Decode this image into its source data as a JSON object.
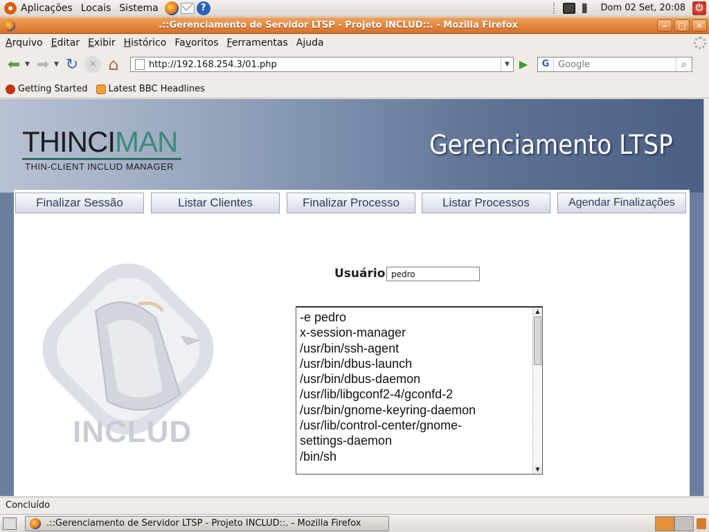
{
  "top_panel": {
    "menus": [
      "Aplicações",
      "Locais",
      "Sistema"
    ],
    "launchers": [
      "firefox-icon",
      "mail-icon",
      "help-icon"
    ],
    "help_glyph": "?",
    "clock": "Dom 02 Set, 20:08"
  },
  "window": {
    "title": ".::Gerenciamento de Servidor LTSP - Projeto INCLUD::. - Mozilla Firefox",
    "controls": {
      "minimize": "–",
      "maximize": "▢",
      "close": "✕"
    }
  },
  "menu_bar": {
    "items": [
      {
        "label": "Arquivo",
        "accel": "A"
      },
      {
        "label": "Editar",
        "accel": "E"
      },
      {
        "label": "Exibir",
        "accel": "E"
      },
      {
        "label": "Histórico",
        "accel": "H"
      },
      {
        "label": "Favoritos",
        "accel": "v"
      },
      {
        "label": "Ferramentas",
        "accel": "F"
      },
      {
        "label": "Ajuda",
        "accel": "j"
      }
    ]
  },
  "nav_bar": {
    "url": "http://192.168.254.3/01.php",
    "search_placeholder": "Google",
    "search_engine_glyph": "G"
  },
  "bookmarks": [
    {
      "label": "Getting Started",
      "icon": "firefox-bookmark-icon"
    },
    {
      "label": "Latest BBC Headlines",
      "icon": "rss-icon"
    }
  ],
  "page": {
    "logo": {
      "thin": "THINCI",
      "man": "MAN",
      "subtitle": "THIN-CLIENT INCLUD MANAGER"
    },
    "banner_title": "Gerenciamento LTSP",
    "tabs": [
      "Finalizar Sessão",
      "Listar Clientes",
      "Finalizar Processo",
      "Listar Processos",
      "Agendar Finalizações"
    ],
    "includ_text": "INCLUD",
    "user_label": "Usuário:",
    "user_value": "pedro",
    "processes": [
      "-e pedro",
      "x-session-manager",
      "/usr/bin/ssh-agent",
      "/usr/bin/dbus-launch",
      "/usr/bin/dbus-daemon",
      "/usr/lib/libgconf2-4/gconfd-2",
      "/usr/bin/gnome-keyring-daemon",
      "/usr/lib/control-center/gnome-",
      "settings-daemon",
      "/bin/sh"
    ]
  },
  "status_bar": {
    "text": "Concluído"
  },
  "taskbar": {
    "task_title": ".::Gerenciamento de Servidor LTSP - Projeto INCLUD::. - Mozilla Firefox"
  }
}
